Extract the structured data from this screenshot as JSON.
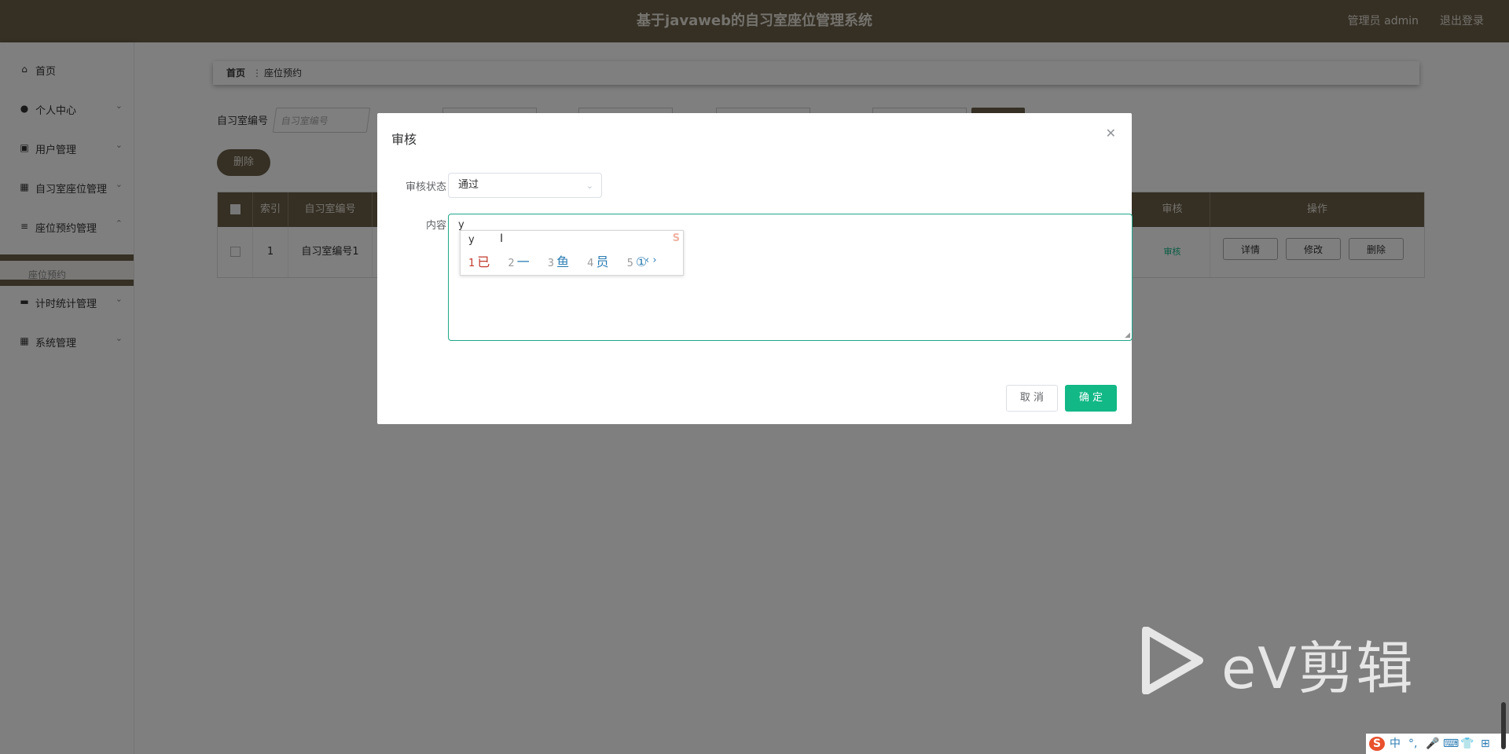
{
  "header": {
    "title": "基于javaweb的自习室座位管理系统",
    "admin": "管理员 admin",
    "logout": "退出登录"
  },
  "sidebar": {
    "items": [
      {
        "label": "首页",
        "icon": "home-icon"
      },
      {
        "label": "个人中心",
        "icon": "user-icon"
      },
      {
        "label": "用户管理",
        "icon": "clipboard-icon"
      },
      {
        "label": "自习室座位管理",
        "icon": "grid-icon"
      },
      {
        "label": "座位预约管理",
        "icon": "sliders-icon"
      },
      {
        "label": "计时统计管理",
        "icon": "printer-icon"
      },
      {
        "label": "系统管理",
        "icon": "grid-icon"
      }
    ],
    "sub_item": "座位预约"
  },
  "breadcrumb": {
    "home": "首页",
    "sep": "⋮",
    "current": "座位预约"
  },
  "search": {
    "label": "自习室编号",
    "placeholder": "自习室编号"
  },
  "delete_button": "删除",
  "table": {
    "headers": [
      "索引",
      "自习室编号",
      "审核",
      "操作"
    ],
    "row": {
      "index": "1",
      "room": "自习室编号1",
      "audit": "审核",
      "ops": [
        "详情",
        "修改",
        "删除"
      ]
    }
  },
  "dialog": {
    "title": "审核",
    "status_label": "审核状态",
    "status_value": "通过",
    "content_label": "内容",
    "content_value": "y",
    "cancel": "取 消",
    "ok": "确 定"
  },
  "ime": {
    "pinyin": "y",
    "candidates": [
      {
        "n": "1",
        "c": "已"
      },
      {
        "n": "2",
        "c": "一"
      },
      {
        "n": "3",
        "c": "鱼"
      },
      {
        "n": "4",
        "c": "员"
      },
      {
        "n": "5",
        "c": "①"
      }
    ],
    "nav": "‹ ›"
  },
  "watermark": "eV剪辑",
  "taskbar": [
    "S",
    "中",
    "°,",
    "🎤",
    "⌨",
    "👕",
    "⊞"
  ],
  "colors": {
    "brand": "#6b5e48",
    "accent": "#12b886",
    "focus": "#1fa688"
  }
}
